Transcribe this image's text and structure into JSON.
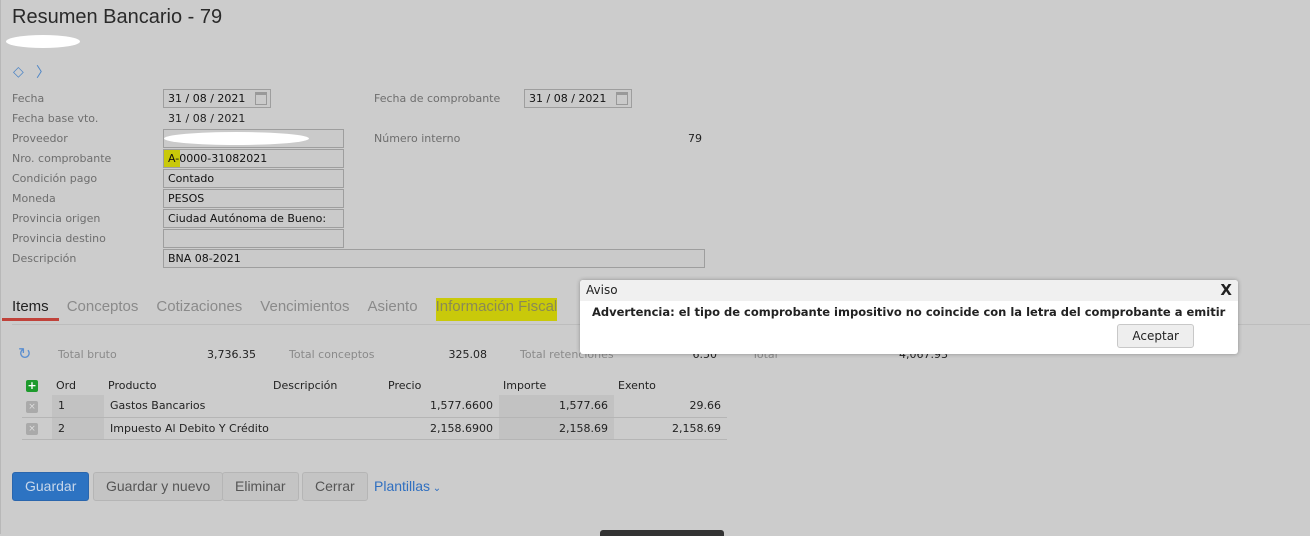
{
  "header": {
    "title": "Resumen Bancario - 79"
  },
  "form": {
    "fecha_label": "Fecha",
    "fecha": "31 / 08 / 2021",
    "fecha_comprobante_label": "Fecha de comprobante",
    "fecha_comprobante": "31 / 08 / 2021",
    "fecha_base_label": "Fecha base vto.",
    "fecha_base": "31 / 08 / 2021",
    "proveedor_label": "Proveedor",
    "numero_interno_label": "Número interno",
    "numero_interno": "79",
    "nro_comprobante_label": "Nro. comprobante",
    "nro_comprobante": "A-0000-31082021",
    "condicion_pago_label": "Condición pago",
    "condicion_pago": "Contado",
    "moneda_label": "Moneda",
    "moneda": "PESOS",
    "provincia_origen_label": "Provincia origen",
    "provincia_origen": "Ciudad Autónoma de Bueno:",
    "provincia_destino_label": "Provincia destino",
    "provincia_destino": "",
    "descripcion_label": "Descripción",
    "descripcion": "BNA 08-2021"
  },
  "tabs": [
    {
      "label": "Items"
    },
    {
      "label": "Conceptos"
    },
    {
      "label": "Cotizaciones"
    },
    {
      "label": "Vencimientos"
    },
    {
      "label": "Asiento"
    },
    {
      "label": "Información Fiscal"
    }
  ],
  "totals": {
    "bruto_label": "Total bruto",
    "bruto": "3,736.35",
    "conceptos_label": "Total conceptos",
    "conceptos": "325.08",
    "retenciones_label": "Total retenciones",
    "retenciones": "6.50",
    "total_label": "Total",
    "total": "4,067.93"
  },
  "table": {
    "headers": [
      "Ord",
      "Producto",
      "Descripción",
      "Precio",
      "Importe",
      "Exento"
    ],
    "rows": [
      {
        "ord": "1",
        "producto": "Gastos Bancarios",
        "descripcion": "",
        "precio": "1,577.6600",
        "importe": "1,577.66",
        "exento": "29.66"
      },
      {
        "ord": "2",
        "producto": "Impuesto Al Debito Y Crédito",
        "descripcion": "",
        "precio": "2,158.6900",
        "importe": "2,158.69",
        "exento": "2,158.69"
      }
    ]
  },
  "actions": {
    "guardar": "Guardar",
    "guardar_nuevo": "Guardar y nuevo",
    "eliminar": "Eliminar",
    "cerrar": "Cerrar",
    "plantillas": "Plantillas"
  },
  "dialog": {
    "title": "Aviso",
    "close": "X",
    "message": "Advertencia: el tipo de comprobante impositivo no coincide con la letra del comprobante a emitir",
    "ok": "Aceptar"
  },
  "colors": {
    "primary": "#2d73c2",
    "highlight": "#c9c90a",
    "active_tab": "#c0423a"
  }
}
